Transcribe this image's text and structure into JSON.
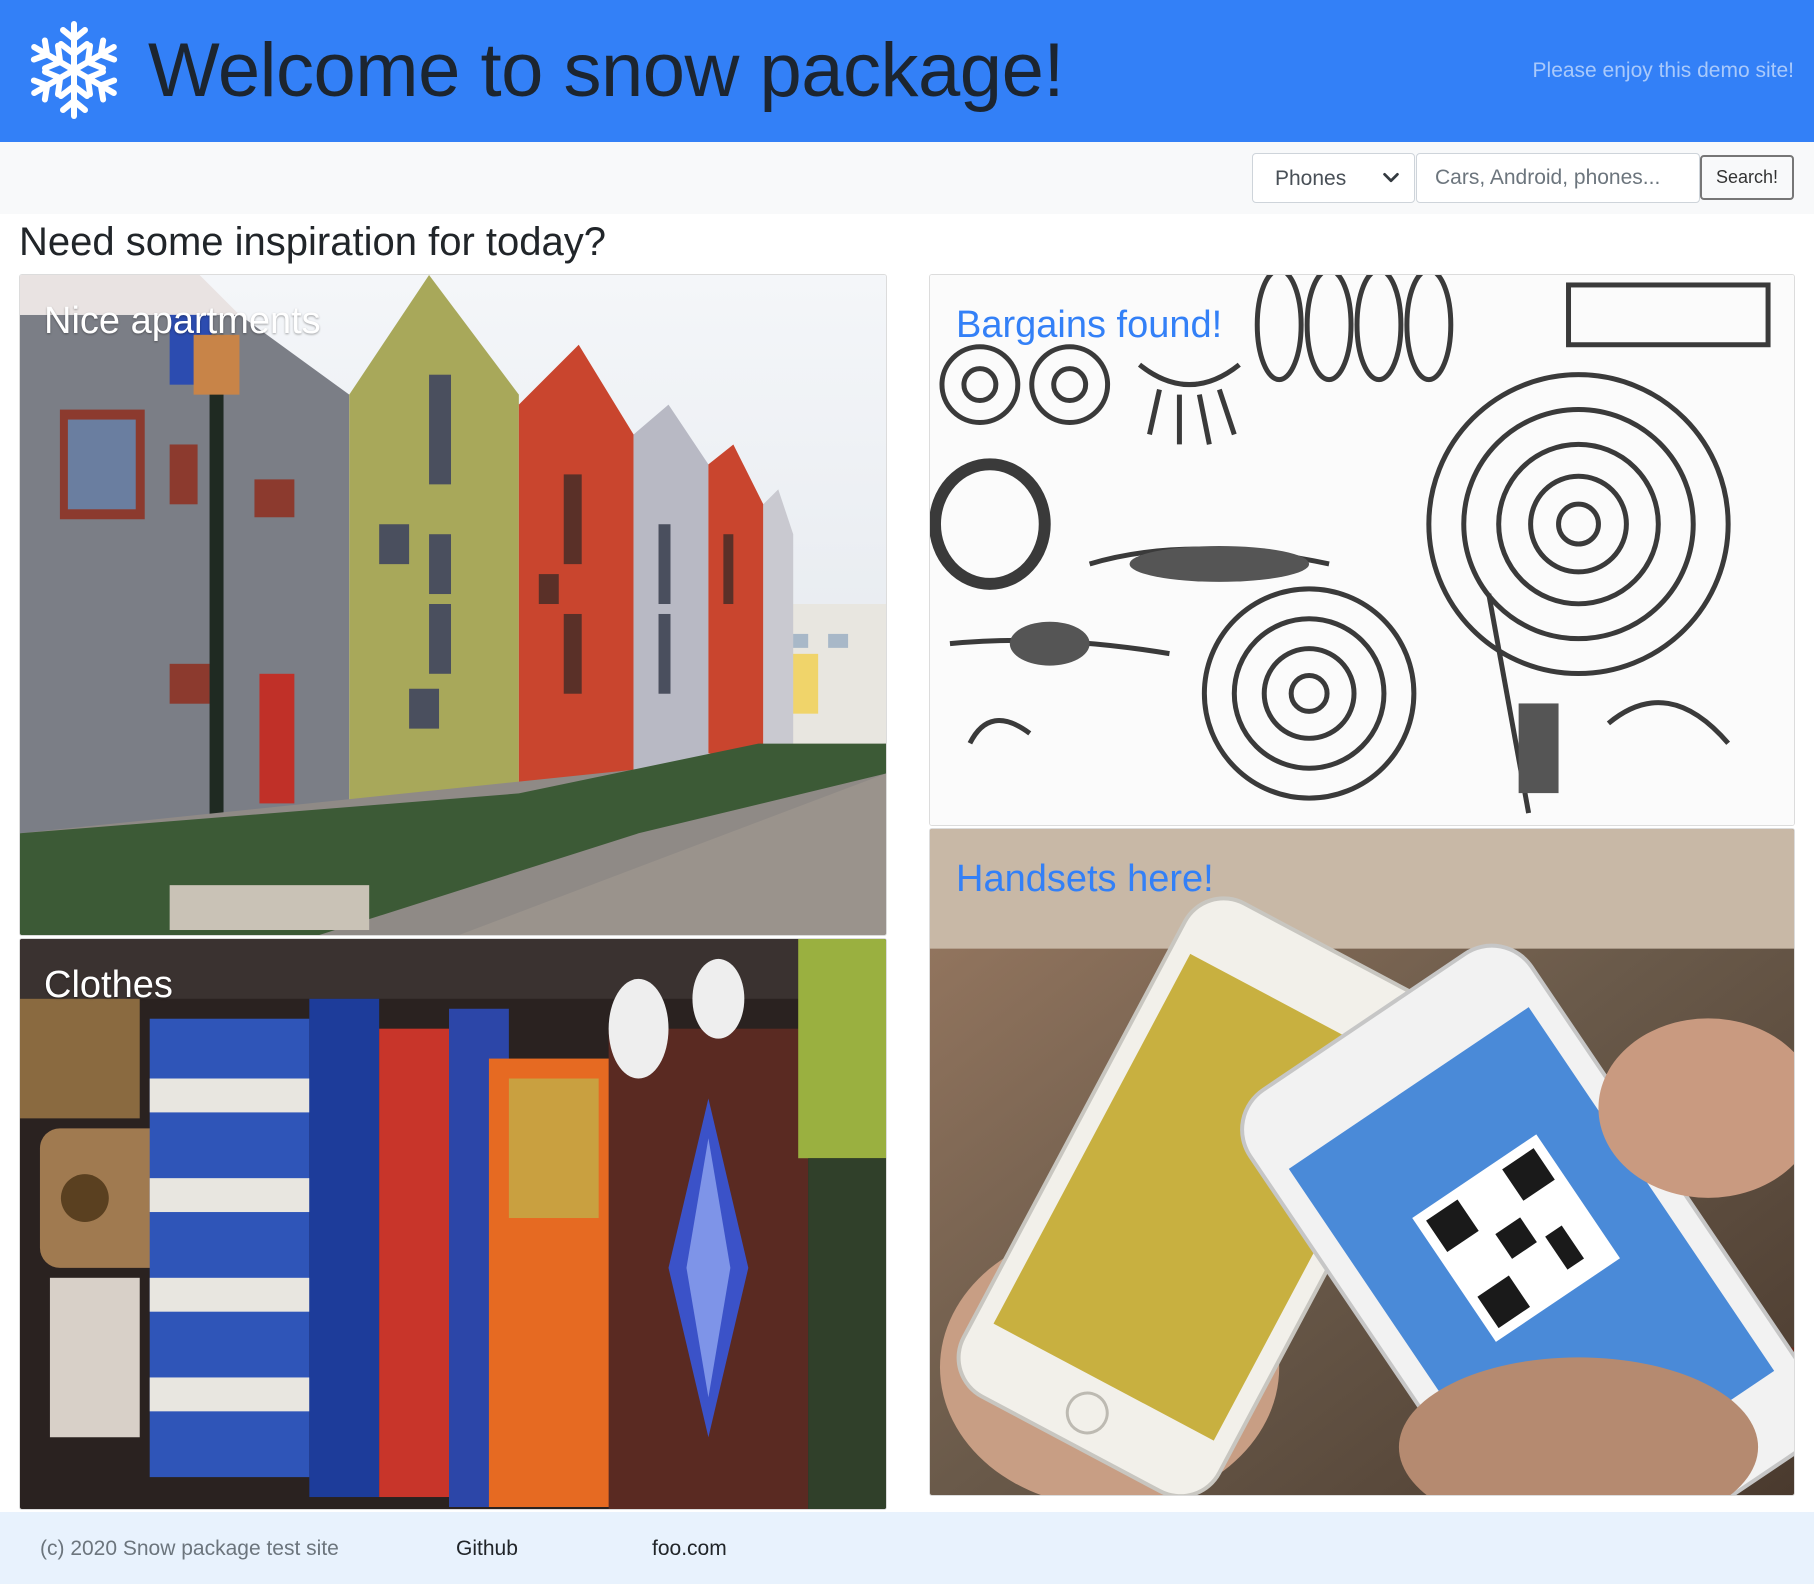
{
  "header": {
    "title": "Welcome to snow package!",
    "tagline": "Please enjoy this demo site!",
    "logo_icon": "snowflake-icon",
    "background_color": "#3380f7"
  },
  "search": {
    "category_selected": "Phones",
    "placeholder": "Cars, Android, phones...",
    "button_label": "Search!"
  },
  "main": {
    "heading": "Need some inspiration for today?",
    "cards": [
      {
        "label": "Nice apartments"
      },
      {
        "label": "Clothes"
      },
      {
        "label": "Bargains found!"
      },
      {
        "label": "Handsets here!"
      }
    ],
    "label_colors": {
      "white": "#ffffff",
      "blue": "#3380f7"
    }
  },
  "footer": {
    "copyright": "(c) 2020 Snow package test site",
    "links": [
      "Github",
      "foo.com"
    ],
    "background_color": "#e8f2fd"
  }
}
